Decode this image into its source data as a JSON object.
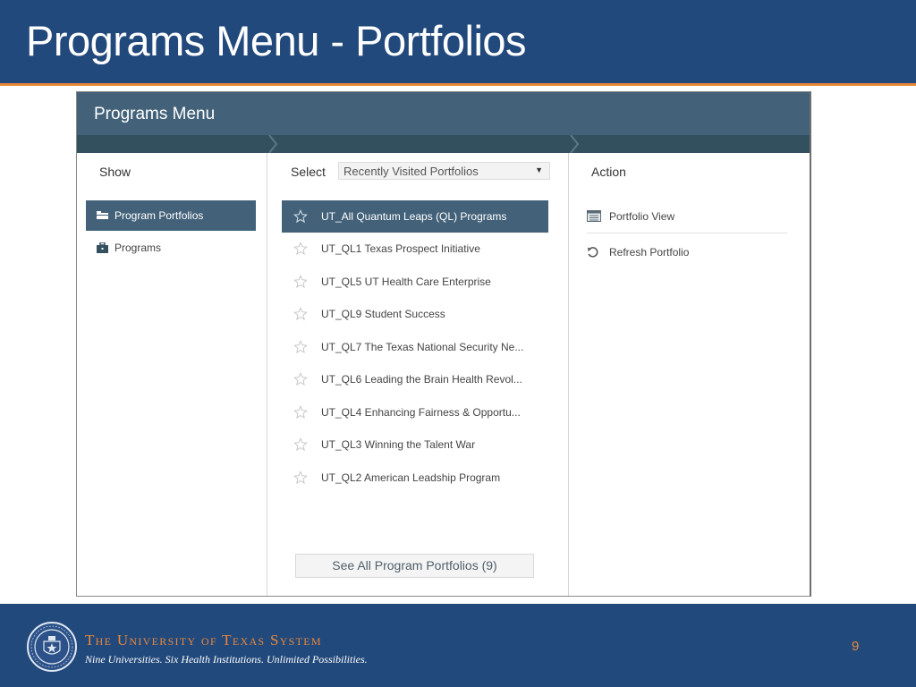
{
  "slide": {
    "title": "Programs Menu - Portfolios",
    "page_number": "9",
    "colors": {
      "header_blue": "#22497c",
      "accent_orange": "#e8873a",
      "app_header": "#43627a",
      "step_bar": "#33505f"
    }
  },
  "app": {
    "title": "Programs Menu",
    "columns": {
      "show": {
        "heading": "Show",
        "items": [
          {
            "label": "Program Portfolios",
            "icon": "folder-icon",
            "active": true
          },
          {
            "label": "Programs",
            "icon": "briefcase-icon",
            "active": false
          }
        ]
      },
      "select": {
        "heading": "Select",
        "dropdown_value": "Recently Visited Portfolios",
        "items": [
          {
            "label": "UT_All Quantum Leaps (QL) Programs",
            "active": true
          },
          {
            "label": "UT_QL1 Texas Prospect Initiative",
            "active": false
          },
          {
            "label": "UT_QL5 UT Health Care Enterprise",
            "active": false
          },
          {
            "label": "UT_QL9 Student Success",
            "active": false
          },
          {
            "label": "UT_QL7 The Texas National Security Ne...",
            "active": false
          },
          {
            "label": "UT_QL6 Leading the Brain Health Revol...",
            "active": false
          },
          {
            "label": "UT_QL4 Enhancing Fairness & Opportu...",
            "active": false
          },
          {
            "label": "UT_QL3 Winning the Talent War",
            "active": false
          },
          {
            "label": "UT_QL2 American Leadship Program",
            "active": false
          }
        ],
        "see_all_label": "See All Program Portfolios (9)"
      },
      "action": {
        "heading": "Action",
        "items": [
          {
            "label": "Portfolio View",
            "icon": "portfolio-view-icon"
          },
          {
            "label": "Refresh Portfolio",
            "icon": "refresh-icon"
          }
        ]
      }
    }
  },
  "footer": {
    "org_name": "The University of Texas System",
    "tagline": "Nine Universities. Six Health Institutions. Unlimited Possibilities."
  }
}
